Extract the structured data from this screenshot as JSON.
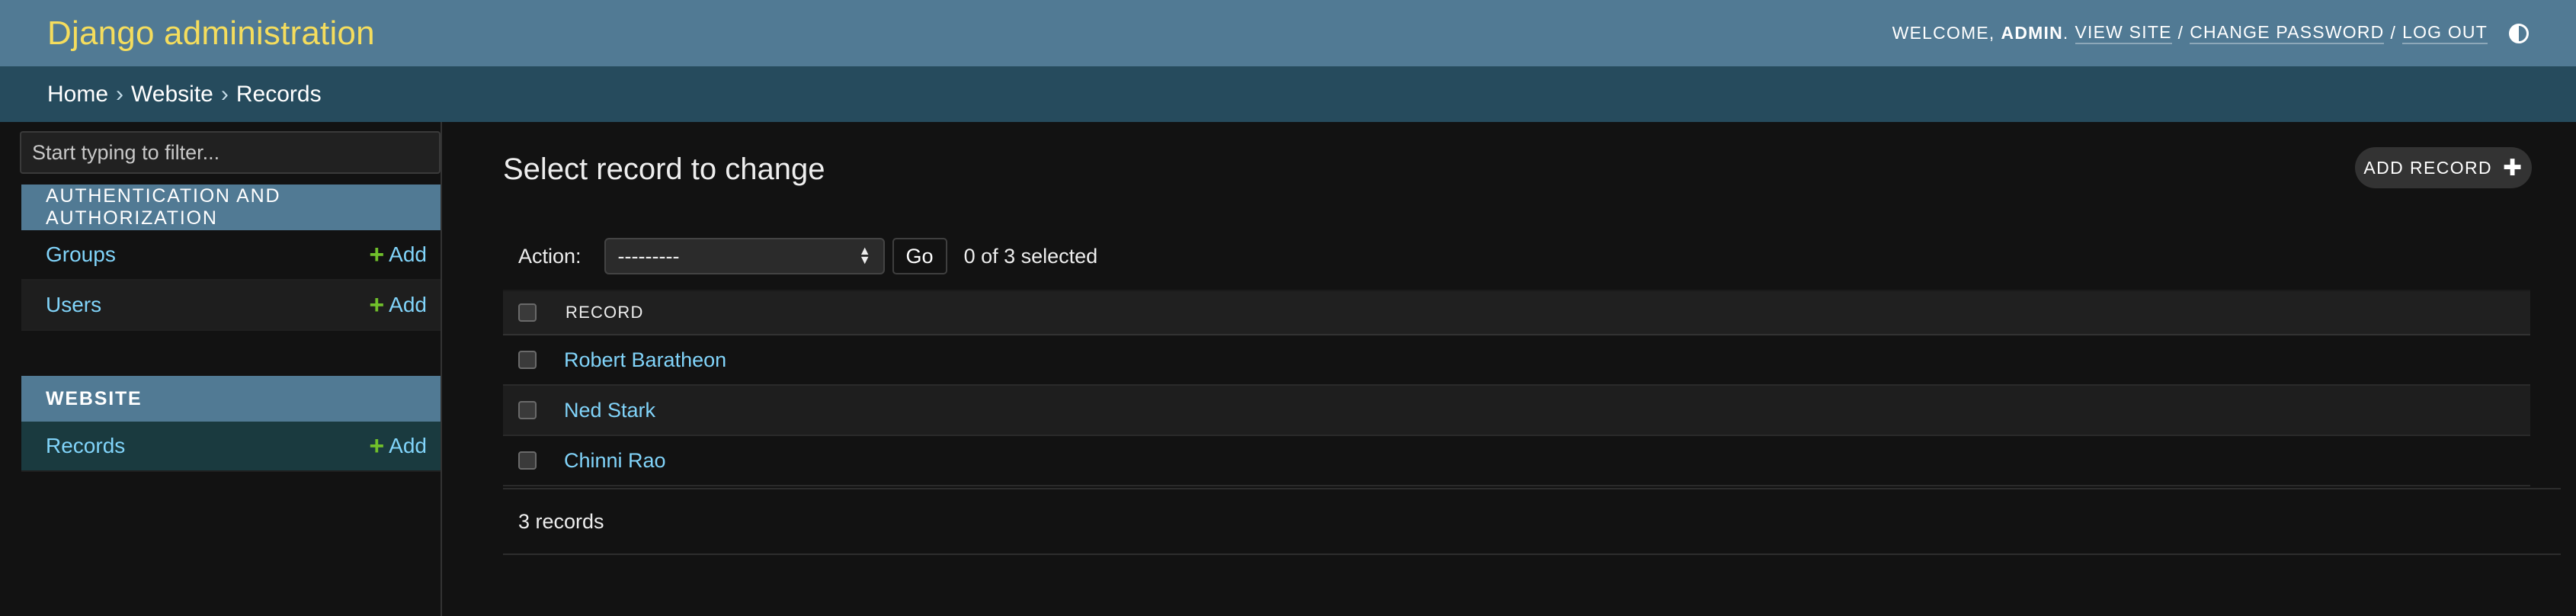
{
  "header": {
    "site_title": "Django administration",
    "welcome": "WELCOME,",
    "username": "ADMIN",
    "view_site": "VIEW SITE",
    "change_password": "CHANGE PASSWORD",
    "log_out": "LOG OUT",
    "separator": "/"
  },
  "breadcrumbs": {
    "home": "Home",
    "app": "Website",
    "current": "Records",
    "separator": "›"
  },
  "sidebar": {
    "filter_placeholder": "Start typing to filter...",
    "modules": [
      {
        "caption": "AUTHENTICATION AND AUTHORIZATION",
        "models": [
          {
            "label": "Groups",
            "add_label": "Add"
          },
          {
            "label": "Users",
            "add_label": "Add"
          }
        ]
      },
      {
        "caption": "WEBSITE",
        "models": [
          {
            "label": "Records",
            "add_label": "Add"
          }
        ]
      }
    ]
  },
  "content": {
    "title": "Select record to change",
    "add_button_label": "ADD RECORD",
    "actions": {
      "label": "Action:",
      "selected_option": "---------",
      "go_label": "Go",
      "selection_counter": "0 of 3 selected"
    },
    "table": {
      "column_header": "RECORD",
      "rows": [
        "Robert Baratheon",
        "Ned Stark",
        "Chinni Rao"
      ]
    },
    "paginator": "3 records"
  },
  "colors": {
    "header_bg": "#517a94",
    "site_title": "#f5dd5d",
    "breadcrumbs_bg": "#264b5d",
    "link": "#81d4fa",
    "add_icon": "#70bf2b",
    "page_bg": "#121212"
  }
}
